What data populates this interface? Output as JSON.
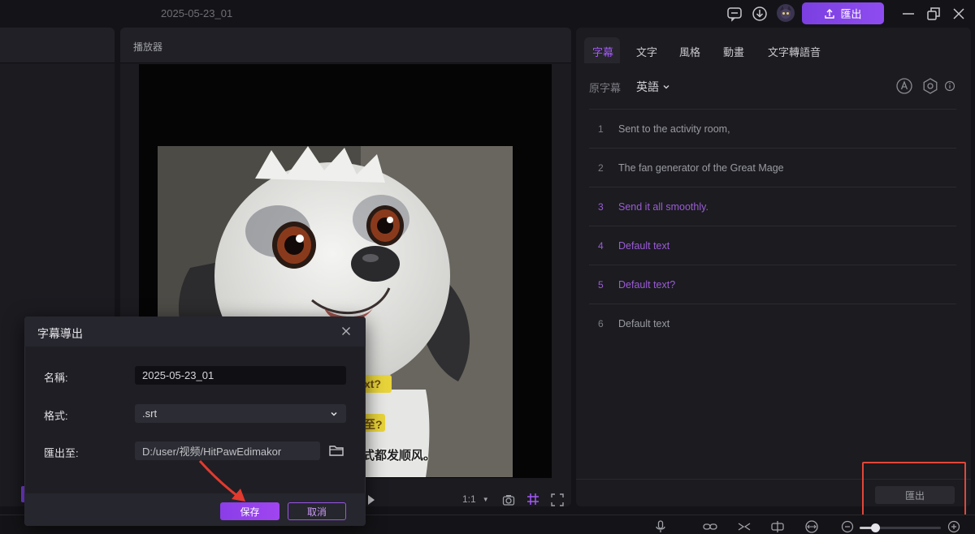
{
  "titlebar": {
    "doc_title": "2025-05-23_01",
    "export_label": "匯出"
  },
  "player": {
    "title": "播放器",
    "ratio": "1:1",
    "caption_fragments": [
      "xt?",
      "至?",
      "式都发顺风。"
    ]
  },
  "right_panel": {
    "tabs": [
      "字幕",
      "文字",
      "風格",
      "動畫",
      "文字轉語音"
    ],
    "active_tab": "字幕",
    "source_label": "原字幕",
    "language": "英語",
    "subtitles": [
      {
        "num": "1",
        "text": "Sent to the activity room,",
        "active": false
      },
      {
        "num": "2",
        "text": "The fan generator of the Great Mage",
        "active": false
      },
      {
        "num": "3",
        "text": "Send it all smoothly.",
        "active": true
      },
      {
        "num": "4",
        "text": "Default text",
        "active": true
      },
      {
        "num": "5",
        "text": "Default text?",
        "active": true
      },
      {
        "num": "6",
        "text": "Default text",
        "active": false
      }
    ],
    "export_button": "匯出"
  },
  "dialog": {
    "title": "字幕導出",
    "name_label": "名稱:",
    "name_value": "2025-05-23_01",
    "format_label": "格式:",
    "format_value": ".srt",
    "export_to_label": "匯出至:",
    "path_value": "D:/user/视频/HitPawEdimakor",
    "save_label": "保存",
    "cancel_label": "取消"
  },
  "colors": {
    "accent": "#8e4cf0",
    "active_subtitle": "#9b5cd6",
    "highlight": "#e2463a"
  }
}
